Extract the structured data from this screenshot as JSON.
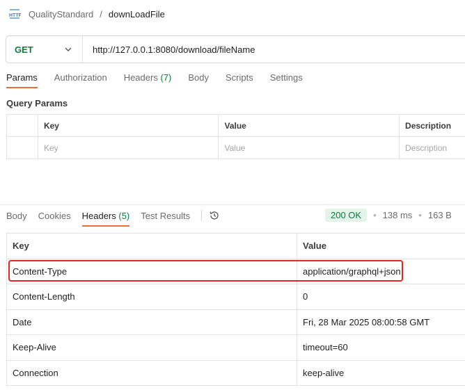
{
  "breadcrumb": {
    "icon": "http-icon",
    "parent": "QualityStandard",
    "separator": "/",
    "current": "downLoadFile"
  },
  "request": {
    "method": "GET",
    "url": "http://127.0.0.1:8080/download/fileName"
  },
  "request_tabs": [
    {
      "label": "Params",
      "active": true
    },
    {
      "label": "Authorization"
    },
    {
      "label": "Headers",
      "count": "(7)"
    },
    {
      "label": "Body"
    },
    {
      "label": "Scripts"
    },
    {
      "label": "Settings"
    }
  ],
  "query_params": {
    "title": "Query Params",
    "columns": [
      "Key",
      "Value",
      "Description"
    ],
    "placeholders": [
      "Key",
      "Value",
      "Description"
    ]
  },
  "response_tabs": [
    {
      "label": "Body"
    },
    {
      "label": "Cookies"
    },
    {
      "label": "Headers",
      "count": "(5)",
      "active": true
    },
    {
      "label": "Test Results"
    }
  ],
  "response_meta": {
    "status": "200 OK",
    "time": "138 ms",
    "size": "163 B",
    "status_color": "#0f7b3e"
  },
  "response_headers": {
    "columns": [
      "Key",
      "Value"
    ],
    "rows": [
      {
        "key": "Content-Type",
        "value": "application/graphql+json",
        "highlighted": true
      },
      {
        "key": "Content-Length",
        "value": "0"
      },
      {
        "key": "Date",
        "value": "Fri, 28 Mar 2025 08:00:58 GMT"
      },
      {
        "key": "Keep-Alive",
        "value": "timeout=60"
      },
      {
        "key": "Connection",
        "value": "keep-alive"
      }
    ]
  },
  "colors": {
    "accent": "#f26b3a",
    "highlight_box": "#e8241d",
    "method": "#0f7b3e"
  }
}
